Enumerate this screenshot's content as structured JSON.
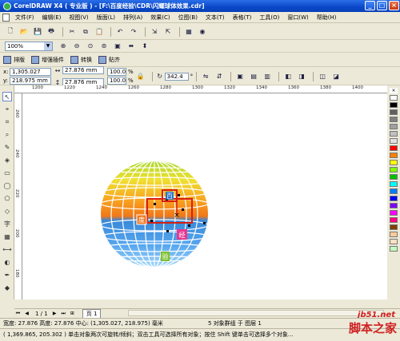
{
  "window": {
    "title": "CorelDRAW X4 ( 专业版 ) - [F:\\百度经验\\CDR\\闪耀球体效果.cdr]",
    "minimize": "_",
    "restore": "□",
    "close": "×"
  },
  "menu": [
    "文件(F)",
    "编辑(E)",
    "视图(V)",
    "版面(L)",
    "排列(A)",
    "效果(C)",
    "位图(B)",
    "文本(T)",
    "表格(T)",
    "工具(O)",
    "窗口(W)",
    "帮助(H)"
  ],
  "menu_right": [
    "_",
    "□",
    "×"
  ],
  "standard_toolbar": {
    "icons": [
      "new-icon",
      "open-icon",
      "save-icon",
      "print-icon",
      "cut-icon",
      "copy-icon",
      "paste-icon",
      "undo-icon",
      "redo-icon",
      "import-icon",
      "export-icon",
      "app-launcher-icon",
      "corel-online-icon"
    ]
  },
  "zoom": {
    "value": "100%"
  },
  "plugin_toolbar": {
    "buttons": [
      "排版",
      "增强插件",
      "转换",
      "贴齐"
    ]
  },
  "property_bar": {
    "x_label": "x:",
    "x_value": "1,305.027 mm",
    "y_label": "y:",
    "y_value": "218.975 mm",
    "w_value": "27.876 mm",
    "h_value": "27.876 mm",
    "scale_x": "100.0",
    "scale_y": "100.0",
    "pct": "%",
    "rotation": "342.4",
    "degree": "°"
  },
  "ruler_top_ticks": [
    "1200",
    "1220",
    "1240",
    "1260",
    "1280",
    "1300",
    "1320",
    "1340",
    "1360",
    "1380",
    "1400"
  ],
  "ruler_left_ticks": [
    "260",
    "240",
    "220",
    "200",
    "180"
  ],
  "canvas_labels": {
    "top": "百",
    "left": "度",
    "right": "经",
    "bottom": "验"
  },
  "pages": {
    "current": "1 / 1",
    "tab": "页 1"
  },
  "status": {
    "line1_left": "宽度: 27.876  高度: 27.876  中心: (1,305.027, 218.975)  毫米",
    "line1_right": "5 对象群组 于 图层 1",
    "line2": "( 1,369.865, 205.302 ) 单击对象两次可旋转/倾斜；双击工具可选择所有对象；按住 Shift 键单击可选择多个对象..."
  },
  "palette_colors": [
    "#ffffff",
    "#000000",
    "#606060",
    "#808080",
    "#a0a0a0",
    "#c0c0c0",
    "#e0e0e0",
    "#ff0000",
    "#ff8000",
    "#ffff00",
    "#80ff00",
    "#00c000",
    "#00ffff",
    "#0080ff",
    "#0000ff",
    "#8000ff",
    "#ff00ff",
    "#ff0080",
    "#804000",
    "#ffcc99",
    "#ffe0c0",
    "#c0ffc0"
  ],
  "watermark": {
    "site": "jb51.net",
    "name": "脚本之家"
  }
}
